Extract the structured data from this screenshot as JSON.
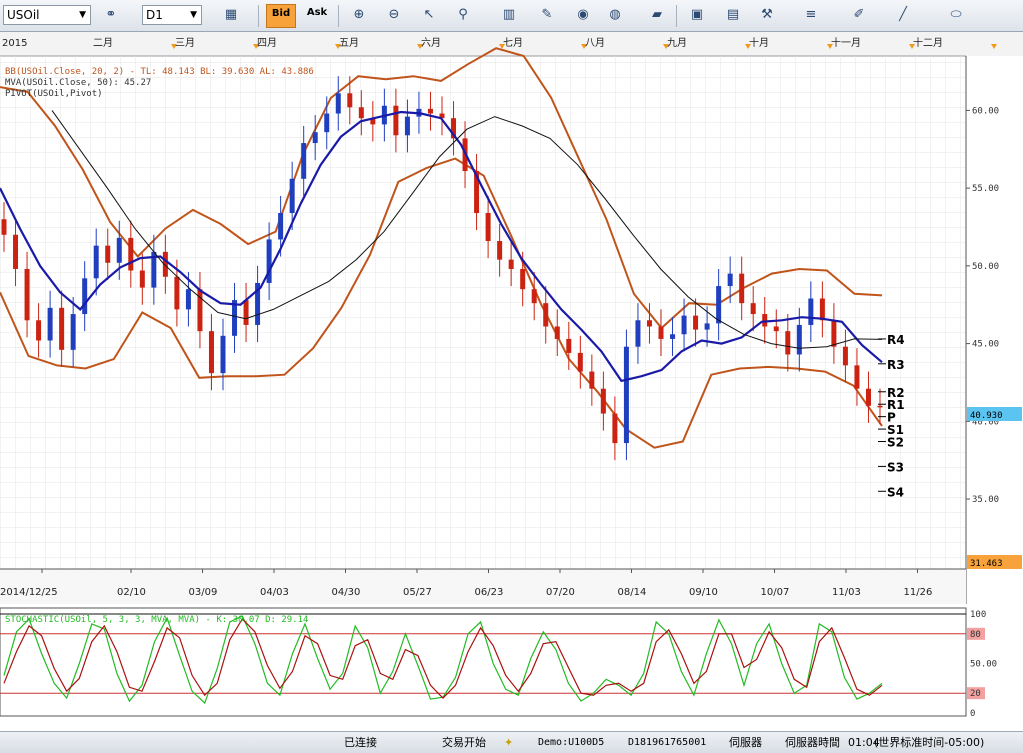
{
  "toolbar": {
    "symbol": "USOil",
    "timeframe": "D1",
    "bid_label": "Bid",
    "ask_label": "Ask"
  },
  "status": {
    "connection": "已连接",
    "trading": "交易开始",
    "account": "Demo:U100D5",
    "id": "D181961765001",
    "server": "伺服器",
    "server_time_label": "伺服器時間",
    "time": "01:04",
    "tz": "(世界标准时间-05:00)"
  },
  "colors": {
    "bull": "#1f3fbf",
    "bear": "#cc2211",
    "bands": "#c0541a",
    "ma20": "#1a1aa8",
    "ma50": "#111111",
    "stoch_k": "#22bb22",
    "stoch_d": "#aa1111"
  },
  "chart_data": [
    {
      "type": "candlestick",
      "indicators": [
        "BB(USOil.Close, 20, 2) -  TL: 48.143  BL: 39.630  AL: 43.886",
        "MVA(USOil.Close, 50): 45.27",
        "PIVOT(USOil,Pivot)"
      ],
      "year_label": "2015",
      "month_labels": [
        {
          "label": "二月",
          "x": "02/01"
        },
        {
          "label": "三月",
          "x": "03/01"
        },
        {
          "label": "四月",
          "x": "04/01"
        },
        {
          "label": "五月",
          "x": "05/01"
        },
        {
          "label": "六月",
          "x": "06/01"
        },
        {
          "label": "七月",
          "x": "07/01"
        },
        {
          "label": "八月",
          "x": "08/01"
        },
        {
          "label": "九月",
          "x": "09/01"
        },
        {
          "label": "十月",
          "x": "10/01"
        },
        {
          "label": "十一月",
          "x": "11/01"
        },
        {
          "label": "十二月",
          "x": "12/01"
        }
      ],
      "x_tick_labels": [
        "2014/12/25",
        "02/10",
        "03/09",
        "04/03",
        "04/30",
        "05/27",
        "06/23",
        "07/20",
        "08/14",
        "09/10",
        "10/07",
        "11/03",
        "11/26"
      ],
      "y_ticks": [
        "35.00",
        "40.00",
        "45.00",
        "50.00",
        "55.00",
        "60.00"
      ],
      "ylim": [
        30.5,
        63.5
      ],
      "last_price": "40.930",
      "low_marker": "31.463",
      "pivots": [
        {
          "name": "R4",
          "value": 45.3
        },
        {
          "name": "R3",
          "value": 43.7
        },
        {
          "name": "R2",
          "value": 41.9
        },
        {
          "name": "R1",
          "value": 41.1
        },
        {
          "name": "P",
          "value": 40.3
        },
        {
          "name": "S1",
          "value": 39.5
        },
        {
          "name": "S2",
          "value": 38.7
        },
        {
          "name": "S3",
          "value": 37.1
        },
        {
          "name": "S4",
          "value": 35.5
        }
      ],
      "close_series": [
        52.0,
        49.8,
        46.5,
        45.2,
        47.3,
        44.6,
        46.9,
        49.2,
        51.3,
        50.2,
        51.8,
        49.7,
        48.6,
        50.9,
        49.3,
        47.2,
        48.5,
        45.8,
        43.1,
        45.5,
        47.8,
        46.2,
        48.9,
        51.7,
        53.4,
        55.6,
        57.9,
        58.6,
        59.8,
        61.1,
        60.2,
        59.5,
        59.1,
        60.3,
        58.4,
        59.6,
        60.1,
        59.8,
        59.5,
        58.2,
        56.1,
        53.4,
        51.6,
        50.4,
        49.8,
        48.5,
        47.6,
        46.1,
        45.3,
        44.4,
        43.2,
        42.1,
        40.5,
        38.6,
        44.8,
        46.5,
        46.1,
        45.3,
        45.6,
        46.8,
        45.9,
        46.3,
        48.7,
        49.5,
        47.6,
        46.9,
        46.1,
        45.8,
        44.3,
        46.2,
        47.9,
        46.5,
        44.8,
        43.6,
        42.1,
        41.0,
        40.9
      ],
      "ma20": [
        55.0,
        52.4,
        50.0,
        48.3,
        47.2,
        48.8,
        49.9,
        50.5,
        50.6,
        49.6,
        48.4,
        47.6,
        47.5,
        48.6,
        51.1,
        54.0,
        56.5,
        58.3,
        59.3,
        59.6,
        59.9,
        59.8,
        59.5,
        57.8,
        55.2,
        52.7,
        50.5,
        48.8,
        47.2,
        45.9,
        44.5,
        42.6,
        42.9,
        43.3,
        44.5,
        45.2,
        45.0,
        45.4,
        46.4,
        46.5,
        46.7,
        46.6,
        46.4,
        44.9,
        43.8
      ],
      "ma50": [
        60.0,
        57.5,
        55.0,
        52.4,
        50.2,
        48.5,
        47.0,
        46.6,
        47.2,
        48.1,
        49.0,
        50.4,
        52.2,
        54.6,
        57.0,
        58.8,
        59.6,
        59.0,
        58.2,
        56.5,
        54.3,
        52.0,
        49.8,
        48.0,
        46.6,
        45.6,
        45.0,
        44.7,
        44.8,
        45.3,
        45.27
      ],
      "bb_upper": [
        61.5,
        61.2,
        59.0,
        56.2,
        52.8,
        50.6,
        52.4,
        53.6,
        52.7,
        51.4,
        52.2,
        57.2,
        60.8,
        62.2,
        62.0,
        62.2,
        61.9,
        63.0,
        64.0,
        63.5,
        60.8,
        56.9,
        53.0,
        48.2,
        46.0,
        47.6,
        47.5,
        48.6,
        49.5,
        49.8,
        49.7,
        48.2,
        48.1
      ],
      "bb_lower": [
        48.3,
        44.2,
        43.6,
        43.4,
        44.0,
        47.0,
        46.0,
        42.8,
        42.9,
        42.9,
        43.0,
        44.7,
        47.3,
        50.7,
        55.4,
        56.3,
        56.9,
        55.8,
        51.8,
        47.6,
        44.0,
        41.9,
        39.5,
        38.3,
        38.7,
        43.0,
        43.4,
        43.5,
        43.4,
        43.2,
        42.3,
        39.7
      ]
    },
    {
      "type": "line",
      "indicator": "STOCHASTIC(USOil, 5, 3, 3, MVA, MVA) -  K: 30.07  D: 29.14",
      "y_ticks": [
        "0",
        "20",
        "50.00",
        "80",
        "100"
      ],
      "ylim": [
        0,
        100
      ],
      "levels": [
        20,
        80
      ],
      "k_series": [
        38,
        82,
        95,
        60,
        30,
        15,
        50,
        90,
        85,
        40,
        12,
        28,
        72,
        96,
        58,
        22,
        10,
        45,
        92,
        98,
        70,
        30,
        18,
        60,
        90,
        55,
        24,
        40,
        88,
        66,
        20,
        42,
        80,
        48,
        14,
        16,
        36,
        80,
        92,
        50,
        24,
        18,
        55,
        82,
        64,
        30,
        12,
        20,
        34,
        28,
        18,
        40,
        92,
        80,
        42,
        18,
        60,
        94,
        70,
        28,
        70,
        90,
        50,
        20,
        28,
        90,
        82,
        36,
        14,
        20,
        30
      ],
      "d_series": [
        30,
        62,
        88,
        78,
        45,
        22,
        35,
        72,
        88,
        62,
        26,
        22,
        52,
        86,
        76,
        38,
        18,
        30,
        74,
        95,
        82,
        48,
        25,
        42,
        78,
        70,
        38,
        34,
        68,
        74,
        40,
        34,
        64,
        58,
        28,
        15,
        28,
        62,
        86,
        68,
        38,
        22,
        40,
        70,
        72,
        46,
        20,
        18,
        28,
        30,
        22,
        30,
        72,
        84,
        60,
        30,
        42,
        80,
        80,
        46,
        54,
        82,
        66,
        34,
        26,
        72,
        86,
        56,
        24,
        18,
        28
      ]
    }
  ]
}
